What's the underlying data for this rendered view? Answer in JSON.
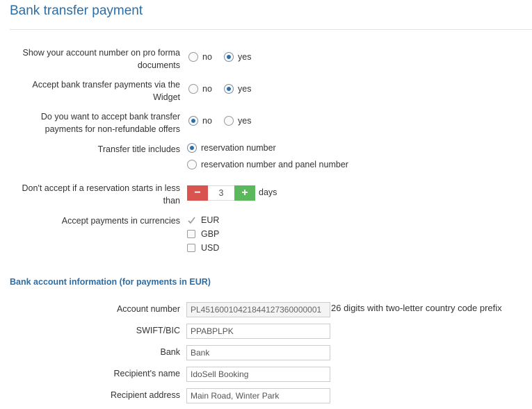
{
  "header": {
    "title": "Bank transfer payment"
  },
  "settings": {
    "show_account": {
      "label": "Show your account number on pro forma documents",
      "options": [
        {
          "label": "no",
          "checked": false
        },
        {
          "label": "yes",
          "checked": true
        }
      ]
    },
    "widget": {
      "label": "Accept bank transfer payments via the Widget",
      "options": [
        {
          "label": "no",
          "checked": false
        },
        {
          "label": "yes",
          "checked": true
        }
      ]
    },
    "non_refundable": {
      "label": "Do you want to accept bank transfer payments for non-refundable offers",
      "options": [
        {
          "label": "no",
          "checked": true
        },
        {
          "label": "yes",
          "checked": false
        }
      ]
    },
    "transfer_title": {
      "label": "Transfer title includes",
      "options": [
        {
          "label": "reservation number",
          "checked": true
        },
        {
          "label": "reservation number and panel number",
          "checked": false
        }
      ]
    },
    "min_days": {
      "label": "Don't accept if a reservation starts in less than",
      "minus": "−",
      "plus": "+",
      "value": "3",
      "unit": "days"
    },
    "currencies": {
      "label": "Accept payments in currencies",
      "items": [
        {
          "label": "EUR",
          "checked": true
        },
        {
          "label": "GBP",
          "checked": false
        },
        {
          "label": "USD",
          "checked": false
        }
      ]
    }
  },
  "bank_info": {
    "title": "Bank account information (for payments in EUR)",
    "account_number": {
      "label": "Account number",
      "value": "PL45160010421844127360000001",
      "hint": "26 digits with two-letter country code prefix"
    },
    "swift": {
      "label": "SWIFT/BIC",
      "value": "PPABPLPK"
    },
    "bank": {
      "label": "Bank",
      "value": "Bank"
    },
    "recipient_name": {
      "label": "Recipient's name",
      "value": "IdoSell Booking"
    },
    "recipient_address": {
      "label": "Recipient address",
      "value": "Main Road, Winter Park"
    }
  },
  "colors": {
    "accent": "#2b6ea6",
    "minus": "#d9534f",
    "plus": "#5cb85c"
  }
}
